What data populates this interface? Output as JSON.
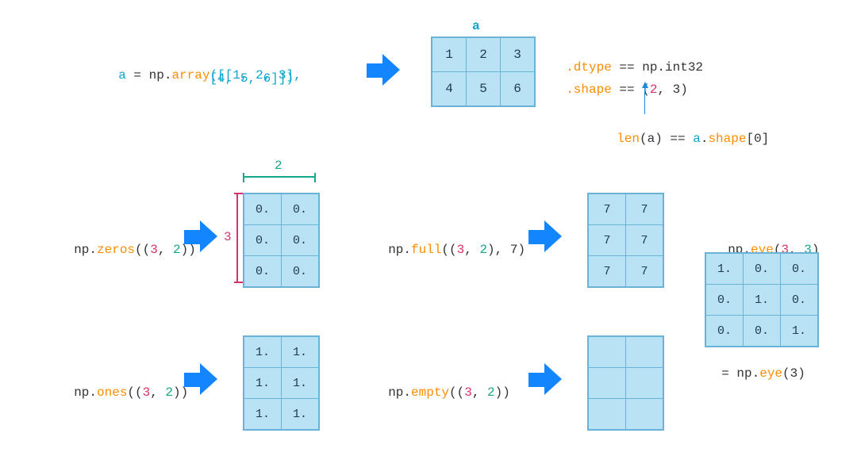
{
  "example_array": {
    "var": "a",
    "eq": " = ",
    "np": "np.",
    "fn": "array",
    "line1_tail": "([[1, 2, 3],",
    "line2": "              [4, 5, 6]])",
    "label_a": "a",
    "cells": [
      [
        "1",
        "2",
        "3"
      ],
      [
        "4",
        "5",
        "6"
      ]
    ],
    "dtype_lbl": ".dtype",
    "dtype_rhs": " == np.int32",
    "shape_lbl": ".shape",
    "shape_rhs_open": " == (",
    "shape_rhs_first": "2",
    "shape_rhs_rest": ", 3)",
    "len_fn": "len",
    "len_args": "(a) == ",
    "len_rhs_a": "a",
    "len_rhs_dot": ".",
    "len_rhs_shape": "shape",
    "len_rhs_idx": "[0]"
  },
  "dim_labels": {
    "cols": "2",
    "rows": "3"
  },
  "zeros": {
    "np": "np.",
    "fn": "zeros",
    "args_open": "((",
    "a0": "3",
    "comma": ", ",
    "a1": "2",
    "args_close": "))",
    "cells": [
      [
        "0.",
        "0."
      ],
      [
        "0.",
        "0."
      ],
      [
        "0.",
        "0."
      ]
    ]
  },
  "ones": {
    "np": "np.",
    "fn": "ones",
    "args_open": "((",
    "a0": "3",
    "comma": ", ",
    "a1": "2",
    "args_close": "))",
    "cells": [
      [
        "1.",
        "1."
      ],
      [
        "1.",
        "1."
      ],
      [
        "1.",
        "1."
      ]
    ]
  },
  "full": {
    "np": "np.",
    "fn": "full",
    "args_open": "((",
    "a0": "3",
    "comma": ", ",
    "a1": "2",
    "args_mid": "), ",
    "fill": "7",
    "args_close": ")",
    "cells": [
      [
        "7",
        "7"
      ],
      [
        "7",
        "7"
      ],
      [
        "7",
        "7"
      ]
    ]
  },
  "empty": {
    "np": "np.",
    "fn": "empty",
    "args_open": "((",
    "a0": "3",
    "comma": ", ",
    "a1": "2",
    "args_close": "))",
    "cells": [
      [
        "",
        ""
      ],
      [
        "",
        ""
      ],
      [
        "",
        ""
      ]
    ]
  },
  "eye": {
    "np": "np.",
    "fn": "eye",
    "args_open": "(",
    "a0": "3",
    "comma": ", ",
    "a1": "3",
    "args_close": ")",
    "cells": [
      [
        "1.",
        "0.",
        "0."
      ],
      [
        "0.",
        "1.",
        "0."
      ],
      [
        "0.",
        "0.",
        "1."
      ]
    ],
    "alt_eq": "= np.",
    "alt_fn": "eye",
    "alt_args": "(3)"
  }
}
